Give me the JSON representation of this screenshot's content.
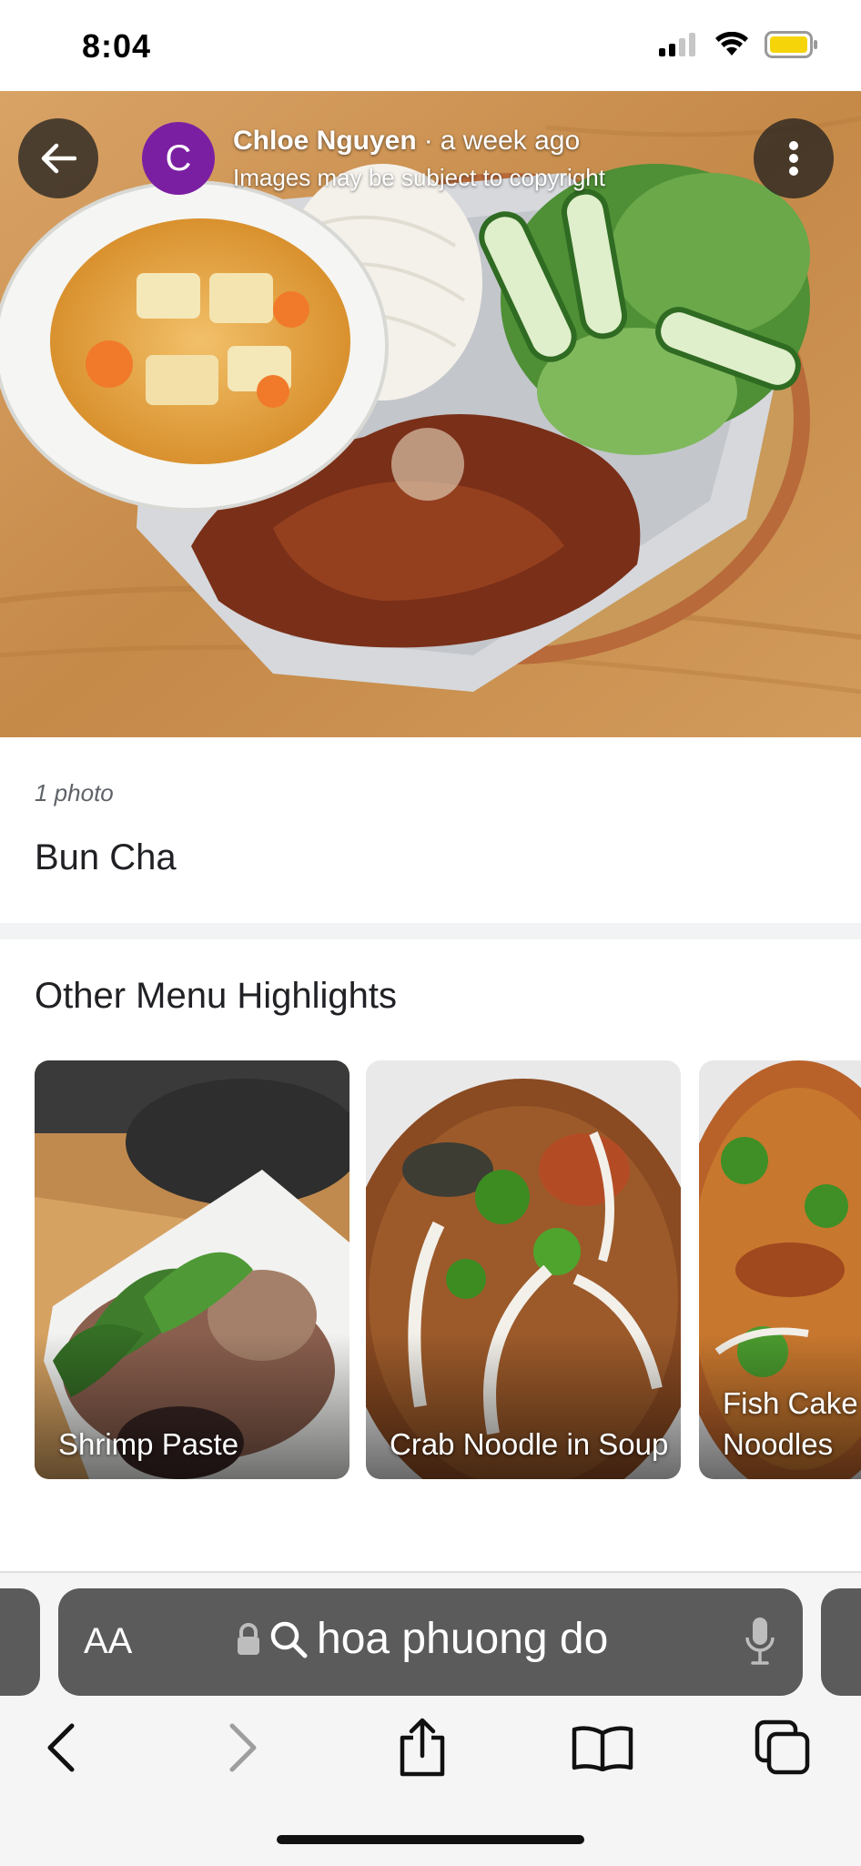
{
  "status_bar": {
    "time": "8:04"
  },
  "photo_header": {
    "avatar_letter": "C",
    "author_name": "Chloe Nguyen",
    "separator": "·",
    "posted": "a week ago",
    "copyright_note": "Images may be subject to copyright"
  },
  "photo_info": {
    "count": "1 photo",
    "dish_name": "Bun Cha"
  },
  "highlights": {
    "title": "Other Menu Highlights",
    "items": [
      {
        "label": "Shrimp Paste"
      },
      {
        "label": "Crab Noodle in Soup"
      },
      {
        "label": "Fish Cake Noodles"
      }
    ]
  },
  "browser": {
    "text_size_label": "AA",
    "address_text": "hoa phuong do"
  },
  "colors": {
    "avatar": "#7b1fa2",
    "address_bar": "#5b5b5b",
    "battery": "#f5d50a"
  }
}
